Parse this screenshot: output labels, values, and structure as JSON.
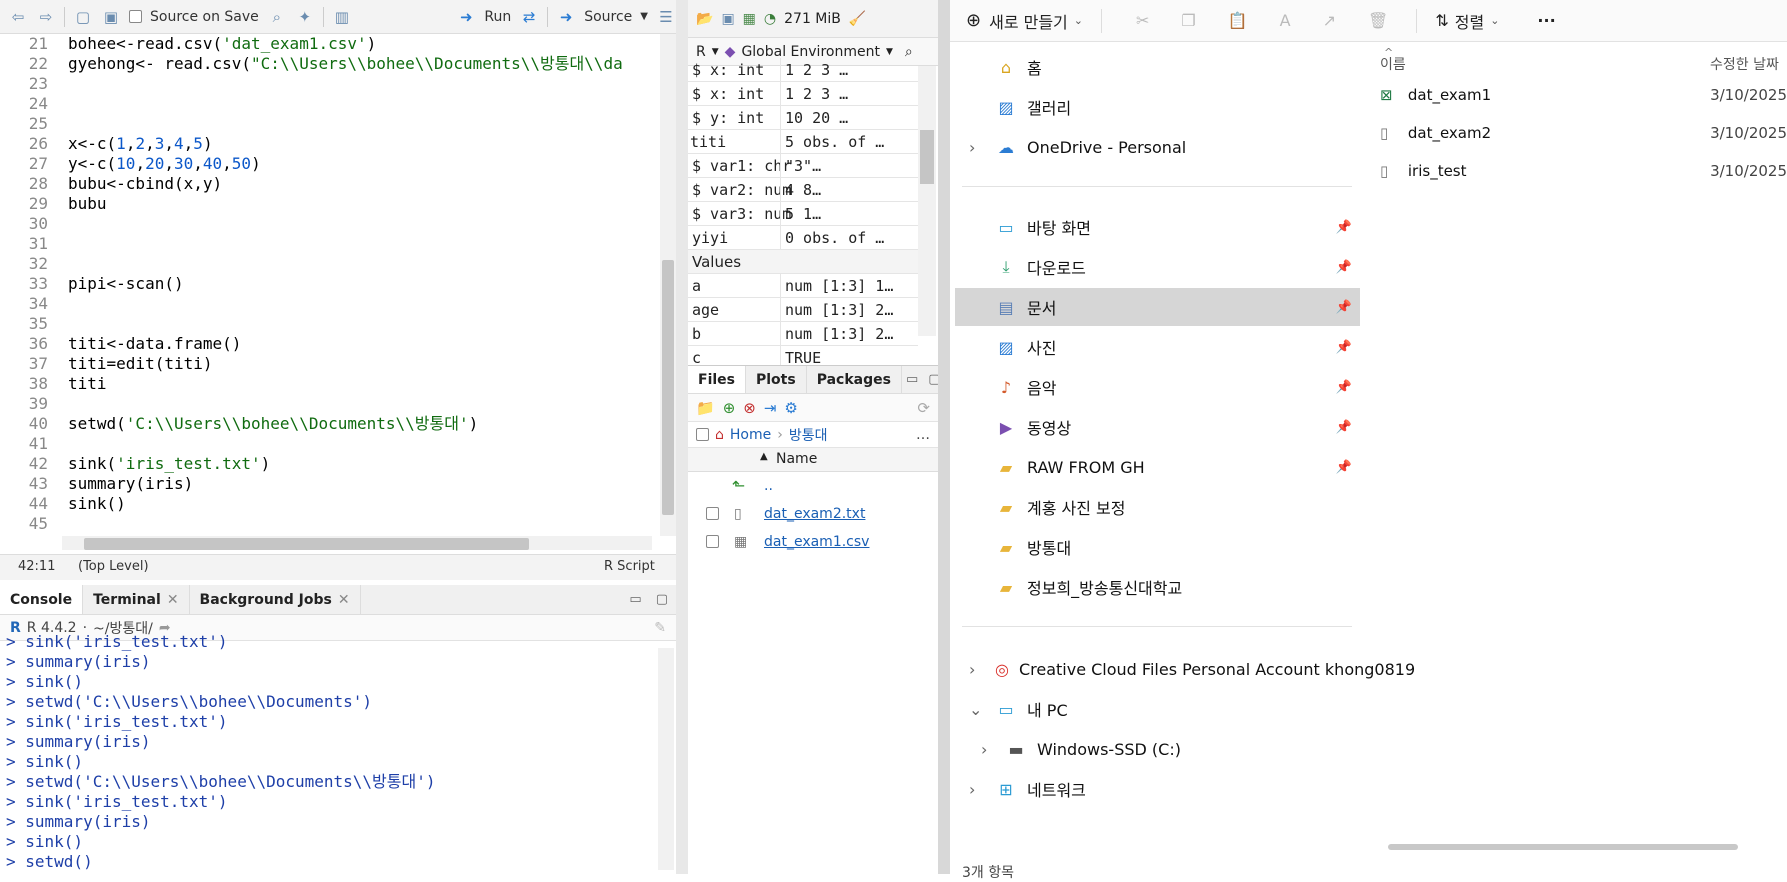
{
  "editor": {
    "toolbar": {
      "source_on_save": "Source on Save",
      "run": "Run",
      "source": "Source"
    },
    "lines": [
      {
        "n": "21",
        "t": "bohee<-read.csv('dat_exam1.csv')"
      },
      {
        "n": "22",
        "t": "gyehong<- read.csv(\"C:\\\\Users\\\\bohee\\\\Documents\\\\방통대\\\\da"
      },
      {
        "n": "23",
        "t": ""
      },
      {
        "n": "24",
        "t": ""
      },
      {
        "n": "25",
        "t": ""
      },
      {
        "n": "26",
        "t": "x<-c(1,2,3,4,5)"
      },
      {
        "n": "27",
        "t": "y<-c(10,20,30,40,50)"
      },
      {
        "n": "28",
        "t": "bubu<-cbind(x,y)"
      },
      {
        "n": "29",
        "t": "bubu"
      },
      {
        "n": "30",
        "t": ""
      },
      {
        "n": "31",
        "t": ""
      },
      {
        "n": "32",
        "t": ""
      },
      {
        "n": "33",
        "t": "pipi<-scan()"
      },
      {
        "n": "34",
        "t": ""
      },
      {
        "n": "35",
        "t": ""
      },
      {
        "n": "36",
        "t": "titi<-data.frame()"
      },
      {
        "n": "37",
        "t": "titi=edit(titi)"
      },
      {
        "n": "38",
        "t": "titi"
      },
      {
        "n": "39",
        "t": ""
      },
      {
        "n": "40",
        "t": "setwd('C:\\\\Users\\\\bohee\\\\Documents\\\\방통대')"
      },
      {
        "n": "41",
        "t": ""
      },
      {
        "n": "42",
        "t": "sink('iris_test.txt')"
      },
      {
        "n": "43",
        "t": "summary(iris)"
      },
      {
        "n": "44",
        "t": "sink()"
      },
      {
        "n": "45",
        "t": ""
      }
    ],
    "status": {
      "position": "42:11",
      "scope": "(Top Level)",
      "type": "R Script"
    }
  },
  "console": {
    "tabs": [
      "Console",
      "Terminal",
      "Background Jobs"
    ],
    "version": "R 4.4.2",
    "wd": "~/방통대/",
    "lines": [
      "> sink('iris_test.txt')",
      "> summary(iris)",
      "> sink()",
      "> setwd('C:\\\\Users\\\\bohee\\\\Documents')",
      "> sink('iris_test.txt')",
      "> summary(iris)",
      "> sink()",
      "> setwd('C:\\\\Users\\\\bohee\\\\Documents\\\\방통대')",
      "> sink('iris_test.txt')",
      "> summary(iris)",
      "> sink()",
      "> setwd()"
    ]
  },
  "environment": {
    "memory": "271 MiB",
    "lang": "R",
    "scope": "Global Environment",
    "rows": [
      {
        "k": "  $ x: int",
        "v": " 1 2 3 …",
        "indent": true
      },
      {
        "k": "  $ x: int",
        "v": " 1 2 3 …",
        "indent": true
      },
      {
        "k": "  $ y: int",
        "v": " 10 20 …",
        "indent": true
      },
      {
        "k": "titi",
        "v": "5 obs. of …",
        "indent": false
      },
      {
        "k": "  $ var1: chr",
        "v": " \"3\"…",
        "indent": true
      },
      {
        "k": "  $ var2: num",
        "v": " 4 8…",
        "indent": true
      },
      {
        "k": "  $ var3: num",
        "v": " 5 1…",
        "indent": true
      },
      {
        "k": "yiyi",
        "v": "0 obs. of …",
        "indent": false
      },
      {
        "k": "Values",
        "v": "",
        "indent": false
      },
      {
        "k": "a",
        "v": "num [1:3] 1…",
        "indent": false
      },
      {
        "k": "age",
        "v": "num [1:3] 2…",
        "indent": false
      },
      {
        "k": "b",
        "v": "num [1:3] 2…",
        "indent": false
      },
      {
        "k": "c",
        "v": "TRUE",
        "indent": false
      }
    ]
  },
  "files": {
    "tabs": [
      "Files",
      "Plots",
      "Packages"
    ],
    "path": [
      "Home",
      "방통대"
    ],
    "header": "Name",
    "up": "..",
    "items": [
      "dat_exam2.txt",
      "dat_exam1.csv"
    ]
  },
  "explorer": {
    "toolbar": {
      "new": "새로 만들기",
      "sort": "정렬"
    },
    "nav": [
      {
        "label": "홈",
        "icon": "home-icon"
      },
      {
        "label": "갤러리",
        "icon": "gallery-icon"
      },
      {
        "label": "OneDrive - Personal",
        "icon": "cloud-icon"
      },
      {
        "label": "바탕 화면",
        "icon": "desktop-icon"
      },
      {
        "label": "다운로드",
        "icon": "download-icon"
      },
      {
        "label": "문서",
        "icon": "document-icon"
      },
      {
        "label": "사진",
        "icon": "picture-icon"
      },
      {
        "label": "음악",
        "icon": "music-icon"
      },
      {
        "label": "동영상",
        "icon": "video-icon"
      },
      {
        "label": "RAW FROM GH",
        "icon": "folder-icon"
      },
      {
        "label": "계홍 사진 보정",
        "icon": "folder-icon"
      },
      {
        "label": "방통대",
        "icon": "folder-icon"
      },
      {
        "label": "정보희_방송통신대학교",
        "icon": "folder-icon"
      },
      {
        "label": "Creative Cloud Files Personal Account khong0819",
        "icon": "creative-cloud-icon"
      },
      {
        "label": "내 PC",
        "icon": "pc-icon"
      },
      {
        "label": "Windows-SSD (C:)",
        "icon": "drive-icon"
      },
      {
        "label": "네트워크",
        "icon": "network-icon"
      }
    ],
    "columns": {
      "name": "이름",
      "modified": "수정한 날짜"
    },
    "files": [
      {
        "name": "dat_exam1",
        "date": "3/10/2025"
      },
      {
        "name": "dat_exam2",
        "date": "3/10/2025"
      },
      {
        "name": "iris_test",
        "date": "3/10/2025"
      }
    ],
    "count": "3개 항목"
  }
}
